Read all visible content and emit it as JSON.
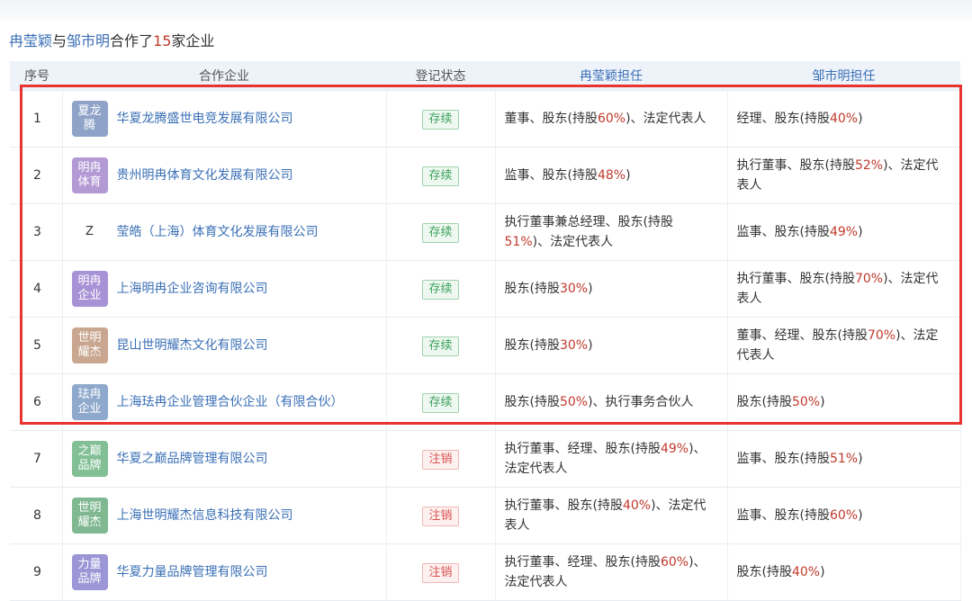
{
  "summary": {
    "person_a": "冉莹颖",
    "connector": "与",
    "person_b": "邹市明",
    "text_mid": "合作了",
    "count": "15",
    "text_end": "家企业"
  },
  "table": {
    "headers": {
      "index": "序号",
      "company": "合作企业",
      "status": "登记状态",
      "role_a": "冉莹颖担任",
      "role_b": "邹市明担任"
    },
    "rows": [
      {
        "index": "1",
        "logo_text": "夏龙腾",
        "company": "华夏龙腾盛世电竞发展有限公司",
        "status": "存续",
        "role_a": "董事、股东(持股",
        "role_a_pct": "60%",
        "role_a_tail": ")、法定代表人",
        "role_b": "经理、股东(持股",
        "role_b_pct": "40%",
        "role_b_tail": ")"
      },
      {
        "index": "2",
        "logo_text": "明冉体育",
        "company": "贵州明冉体育文化发展有限公司",
        "status": "存续",
        "role_a": "监事、股东(持股",
        "role_a_pct": "48%",
        "role_a_tail": ")",
        "role_b": "执行董事、股东(持股",
        "role_b_pct": "52%",
        "role_b_tail": ")、法定代表人"
      },
      {
        "index": "3",
        "logo_text": "Z",
        "company": "莹皓（上海）体育文化发展有限公司",
        "status": "存续",
        "role_a": "执行董事兼总经理、股东(持股",
        "role_a_pct": "51%",
        "role_a_tail": ")、法定代表人",
        "role_b": "监事、股东(持股",
        "role_b_pct": "49%",
        "role_b_tail": ")"
      },
      {
        "index": "4",
        "logo_text": "明冉企业",
        "company": "上海明冉企业咨询有限公司",
        "status": "存续",
        "role_a": "股东(持股",
        "role_a_pct": "30%",
        "role_a_tail": ")",
        "role_b": "执行董事、股东(持股",
        "role_b_pct": "70%",
        "role_b_tail": ")、法定代表人"
      },
      {
        "index": "5",
        "logo_text": "世明耀杰",
        "company": "昆山世明耀杰文化有限公司",
        "status": "存续",
        "role_a": "股东(持股",
        "role_a_pct": "30%",
        "role_a_tail": ")",
        "role_b": "董事、经理、股东(持股",
        "role_b_pct": "70%",
        "role_b_tail": ")、法定代表人"
      },
      {
        "index": "6",
        "logo_text": "珐冉企业",
        "company": "上海珐冉企业管理合伙企业（有限合伙）",
        "status": "存续",
        "role_a": "股东(持股",
        "role_a_pct": "50%",
        "role_a_tail": ")、执行事务合伙人",
        "role_b": "股东(持股",
        "role_b_pct": "50%",
        "role_b_tail": ")"
      },
      {
        "index": "7",
        "logo_text": "之巅品牌",
        "company": "华夏之巅品牌管理有限公司",
        "status": "注销",
        "role_a": "执行董事、经理、股东(持股",
        "role_a_pct": "49%",
        "role_a_tail": ")、法定代表人",
        "role_b": "监事、股东(持股",
        "role_b_pct": "51%",
        "role_b_tail": ")"
      },
      {
        "index": "8",
        "logo_text": "世明耀杰",
        "company": "上海世明耀杰信息科技有限公司",
        "status": "注销",
        "role_a": "执行董事、股东(持股",
        "role_a_pct": "40%",
        "role_a_tail": ")、法定代表人",
        "role_b": "监事、股东(持股",
        "role_b_pct": "60%",
        "role_b_tail": ")"
      },
      {
        "index": "9",
        "logo_text": "力量品牌",
        "company": "华夏力量品牌管理有限公司",
        "status": "注销",
        "role_a": "执行董事、经理、股东(持股",
        "role_a_pct": "60%",
        "role_a_tail": ")、法定代表人",
        "role_b": "股东(持股",
        "role_b_pct": "40%",
        "role_b_tail": ")"
      }
    ]
  },
  "colors": {
    "link": "#3a6fb5",
    "percent": "#c0392b",
    "status_active": "#3aa05a",
    "status_cancelled": "#d9534f",
    "highlight": "#e8342f"
  }
}
